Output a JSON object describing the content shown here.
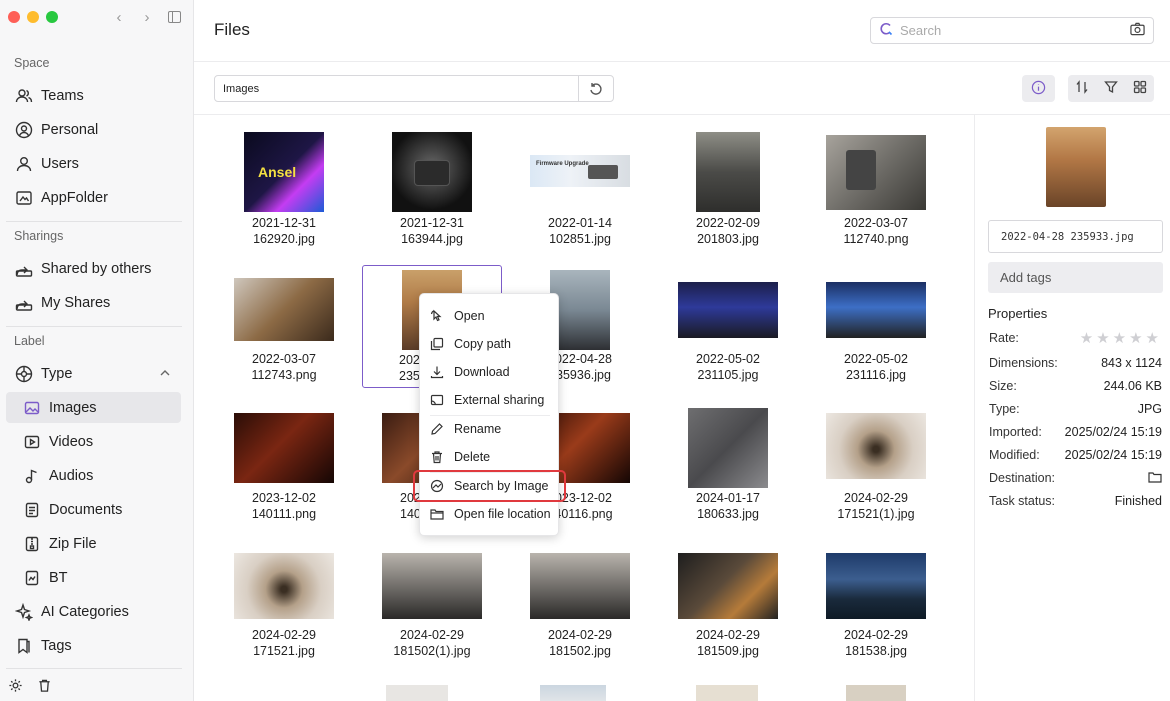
{
  "window": {
    "traffic_colors": [
      "#fe5f57",
      "#febc2e",
      "#28c840"
    ]
  },
  "sidebar": {
    "sections": {
      "space": "Space",
      "sharings": "Sharings",
      "label": "Label"
    },
    "space_items": [
      {
        "label": "Teams",
        "icon": "teams-icon"
      },
      {
        "label": "Personal",
        "icon": "personal-icon"
      },
      {
        "label": "Users",
        "icon": "user-icon"
      },
      {
        "label": "AppFolder",
        "icon": "app-folder-icon"
      }
    ],
    "sharing_items": [
      {
        "label": "Shared by others",
        "icon": "share-icon"
      },
      {
        "label": "My Shares",
        "icon": "share-icon"
      }
    ],
    "type_label": "Type",
    "type_items": [
      {
        "label": "Images",
        "icon": "image-icon"
      },
      {
        "label": "Videos",
        "icon": "video-icon"
      },
      {
        "label": "Audios",
        "icon": "audio-icon"
      },
      {
        "label": "Documents",
        "icon": "document-icon"
      },
      {
        "label": "Zip File",
        "icon": "zip-icon"
      },
      {
        "label": "BT",
        "icon": "bt-icon"
      }
    ],
    "ai_categories": "AI Categories",
    "tags": "Tags"
  },
  "header": {
    "title": "Files",
    "search_placeholder": "Search"
  },
  "pathbar": {
    "value": "Images"
  },
  "files": [
    {
      "date": "2021-12-31",
      "name": "162920.jpg"
    },
    {
      "date": "2021-12-31",
      "name": "163944.jpg"
    },
    {
      "date": "2022-01-14",
      "name": "102851.jpg"
    },
    {
      "date": "2022-02-09",
      "name": "201803.jpg"
    },
    {
      "date": "2022-03-07",
      "name": "112740.png"
    },
    {
      "date": "2022-03-07",
      "name": "112743.png"
    },
    {
      "date": "202",
      "name": "235"
    },
    {
      "date": "2022-04-28",
      "name": "235936.jpg"
    },
    {
      "date": "2022-05-02",
      "name": "231105.jpg"
    },
    {
      "date": "2022-05-02",
      "name": "231116.jpg"
    },
    {
      "date": "2023-12-02",
      "name": "140111.png"
    },
    {
      "date": "202",
      "name": "140"
    },
    {
      "date": "2023-12-02",
      "name": "140116.png"
    },
    {
      "date": "2024-01-17",
      "name": "180633.jpg"
    },
    {
      "date": "2024-02-29",
      "name": "171521(1).jpg"
    },
    {
      "date": "2024-02-29",
      "name": "171521.jpg"
    },
    {
      "date": "2024-02-29",
      "name": "181502(1).jpg"
    },
    {
      "date": "2024-02-29",
      "name": "181502.jpg"
    },
    {
      "date": "2024-02-29",
      "name": "181509.jpg"
    },
    {
      "date": "2024-02-29",
      "name": "181538.jpg"
    }
  ],
  "context_menu": [
    {
      "label": "Open",
      "icon": "open-icon"
    },
    {
      "label": "Copy path",
      "icon": "copy-icon"
    },
    {
      "label": "Download",
      "icon": "download-icon"
    },
    {
      "label": "External sharing",
      "icon": "external-share-icon"
    },
    {
      "label": "Rename",
      "icon": "rename-icon"
    },
    {
      "label": "Delete",
      "icon": "delete-icon"
    },
    {
      "label": "Search by Image",
      "icon": "image-search-icon"
    },
    {
      "label": "Open file location",
      "icon": "folder-icon"
    }
  ],
  "details": {
    "filename": "2022-04-28 235933.jpg",
    "add_tags": "Add tags",
    "properties_title": "Properties",
    "rate_label": "Rate:",
    "rating": 0,
    "rows": [
      {
        "key": "Dimensions:",
        "value": "843 x 1124"
      },
      {
        "key": "Size:",
        "value": "244.06 KB"
      },
      {
        "key": "Type:",
        "value": "JPG"
      },
      {
        "key": "Imported:",
        "value": "2025/02/24 15:19"
      },
      {
        "key": "Modified:",
        "value": "2025/02/24 15:19"
      },
      {
        "key": "Destination:",
        "value": ""
      },
      {
        "key": "Task status:",
        "value": "Finished"
      }
    ]
  },
  "colors": {
    "accent": "#7c5cc9",
    "highlight": "#e0393e"
  }
}
